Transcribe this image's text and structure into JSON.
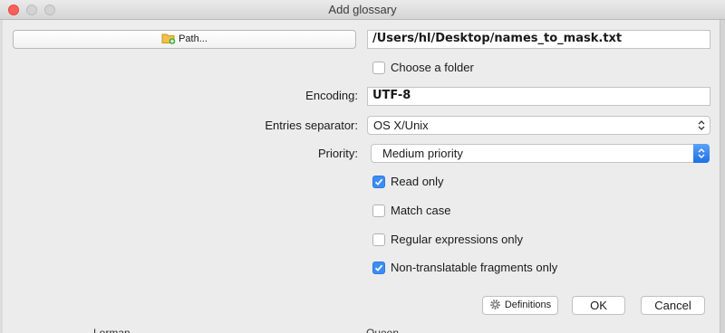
{
  "window": {
    "title": "Add glossary"
  },
  "path": {
    "button_label": "Path...",
    "value": "/Users/hl/Desktop/names_to_mask.txt"
  },
  "choose_folder": {
    "label": "Choose a folder",
    "checked": false
  },
  "encoding": {
    "label": "Encoding:",
    "value": "UTF-8"
  },
  "separator": {
    "label": "Entries separator:",
    "value": "OS X/Unix"
  },
  "priority": {
    "label": "Priority:",
    "value": "Medium priority"
  },
  "options": [
    {
      "label": "Read only",
      "checked": true
    },
    {
      "label": "Match case",
      "checked": false
    },
    {
      "label": "Regular expressions only",
      "checked": false
    },
    {
      "label": "Non-translatable fragments only",
      "checked": true
    }
  ],
  "buttons": {
    "definitions": "Definitions",
    "ok": "OK",
    "cancel": "Cancel"
  },
  "colors": {
    "accent": "#3b8df5",
    "close": "#fc605b"
  },
  "icons": {
    "path": "folder-add-icon",
    "definitions": "gear-icon",
    "separator": "stepper-icon",
    "priority": "dropdown-arrows-icon"
  },
  "background_peek": {
    "left": "Lorman",
    "right": "Queen"
  }
}
